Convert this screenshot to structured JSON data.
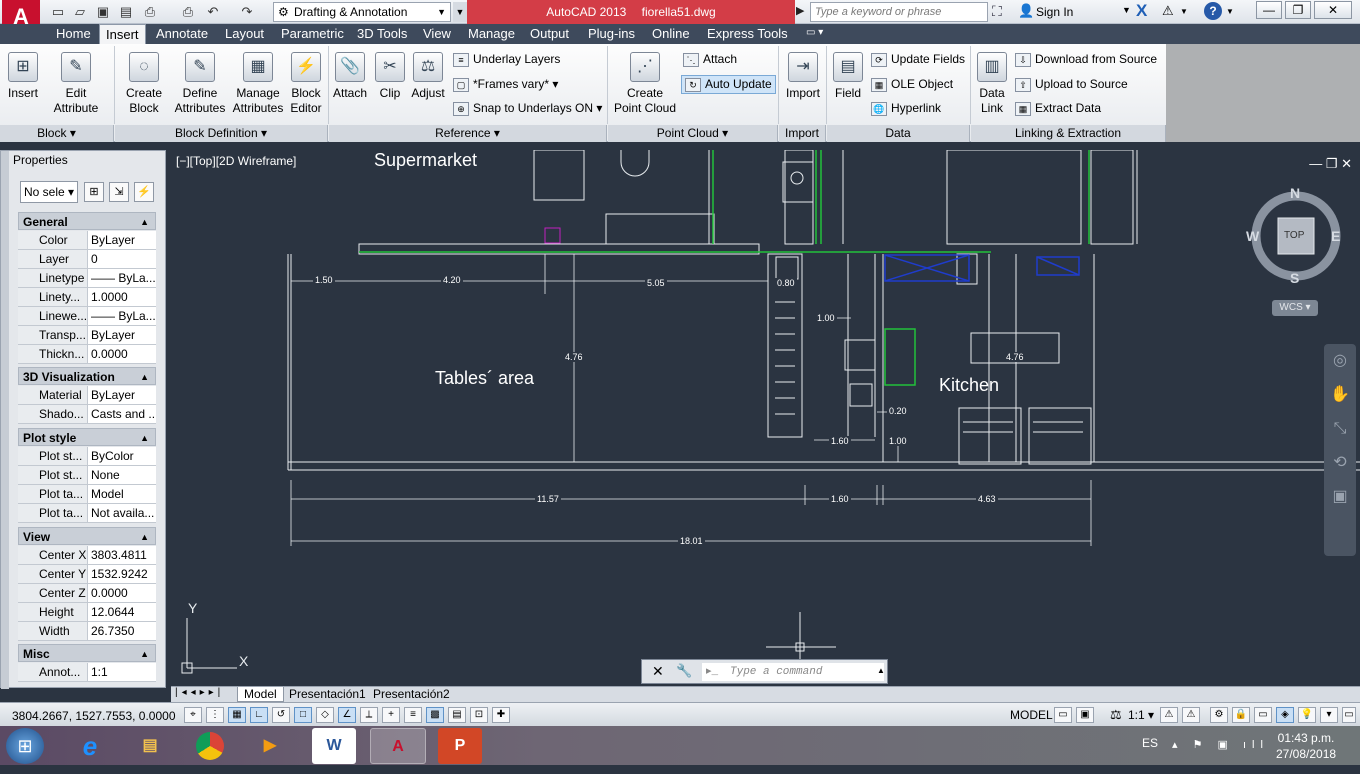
{
  "title_bar": {
    "app_logo": "A",
    "workspace": "Drafting & Annotation",
    "app_name": "AutoCAD 2013",
    "file_name": "fiorella51.dwg",
    "search_placeholder": "Type a keyword or phrase",
    "sign_in": "Sign In"
  },
  "ribbon_tabs": [
    "Home",
    "Insert",
    "Annotate",
    "Layout",
    "Parametric",
    "3D Tools",
    "View",
    "Manage",
    "Output",
    "Plug-ins",
    "Online",
    "Express Tools"
  ],
  "active_tab": "Insert",
  "ribbon": {
    "block": {
      "label": "Block",
      "insert": "Insert",
      "edit_attr_1": "Edit",
      "edit_attr_2": "Attribute"
    },
    "block_def": {
      "label": "Block Definition",
      "create_1": "Create",
      "create_2": "Block",
      "define_1": "Define",
      "define_2": "Attributes",
      "manage_1": "Manage",
      "manage_2": "Attributes",
      "editor_1": "Block",
      "editor_2": "Editor"
    },
    "reference": {
      "label": "Reference",
      "attach": "Attach",
      "clip": "Clip",
      "adjust": "Adjust",
      "underlay_layers": "Underlay Layers",
      "frames": "*Frames vary*",
      "snap": "Snap to Underlays ON"
    },
    "point_cloud": {
      "label": "Point Cloud",
      "create_1": "Create",
      "create_2": "Point Cloud",
      "attach": "Attach",
      "auto_update": "Auto Update"
    },
    "import": {
      "label": "Import",
      "import": "Import"
    },
    "data": {
      "label": "Data",
      "field": "Field",
      "update_fields": "Update Fields",
      "ole_object": "OLE Object",
      "hyperlink": "Hyperlink"
    },
    "linking": {
      "label": "Linking & Extraction",
      "data_link_1": "Data",
      "data_link_2": "Link",
      "download": "Download from Source",
      "upload": "Upload to Source",
      "extract": "Extract  Data"
    }
  },
  "properties": {
    "title": "Properties",
    "selection": "No sele",
    "sections": {
      "general": {
        "title": "General",
        "rows": [
          [
            "Color",
            "ByLayer"
          ],
          [
            "Layer",
            "0"
          ],
          [
            "Linetype",
            "—— ByLa..."
          ],
          [
            "Linety...",
            "1.0000"
          ],
          [
            "Linewe...",
            "—— ByLa..."
          ],
          [
            "Transp...",
            "ByLayer"
          ],
          [
            "Thickn...",
            "0.0000"
          ]
        ]
      },
      "viz3d": {
        "title": "3D Visualization",
        "rows": [
          [
            "Material",
            "ByLayer"
          ],
          [
            "Shado...",
            "Casts and ..."
          ]
        ]
      },
      "plot": {
        "title": "Plot style",
        "rows": [
          [
            "Plot st...",
            "ByColor"
          ],
          [
            "Plot st...",
            "None"
          ],
          [
            "Plot ta...",
            "Model"
          ],
          [
            "Plot ta...",
            "Not availa..."
          ]
        ]
      },
      "view": {
        "title": "View",
        "rows": [
          [
            "Center X",
            "3803.4811"
          ],
          [
            "Center Y",
            "1532.9242"
          ],
          [
            "Center Z",
            "0.0000"
          ],
          [
            "Height",
            "12.0644"
          ],
          [
            "Width",
            "26.7350"
          ]
        ]
      },
      "misc": {
        "title": "Misc",
        "rows": [
          [
            "Annot...",
            "1:1"
          ]
        ]
      }
    }
  },
  "viewport": {
    "label": "[−][Top][2D Wireframe]",
    "rooms": {
      "supermarket": "Supermarket",
      "tables": "Tables´ area",
      "kitchen": "Kitchen"
    },
    "dims": {
      "d150": "1.50",
      "d420": "4.20",
      "d505": "5.05",
      "d080": "0.80",
      "d100a": "1.00",
      "d476a": "4.76",
      "d476b": "4.76",
      "d020": "0.20",
      "d160a": "1.60",
      "d100b": "1.00",
      "d1157": "11.57",
      "d160b": "1.60",
      "d463": "4.63",
      "d1801": "18.01"
    },
    "viewcube": {
      "top": "TOP",
      "n": "N",
      "s": "S",
      "e": "E",
      "w": "W",
      "wcs": "WCS"
    },
    "ucs": {
      "x": "X",
      "y": "Y"
    }
  },
  "command_line": {
    "placeholder": "Type  a  command"
  },
  "layout_tabs": [
    "Model",
    "Presentación1",
    "Presentación2"
  ],
  "status": {
    "coords": "3804.2667, 1527.7553, 0.0000",
    "model": "MODEL",
    "scale": "1:1"
  },
  "taskbar": {
    "lang": "ES",
    "time": "01:43 p.m.",
    "date": "27/08/2018"
  },
  "colors": {
    "accent_red": "#d33d47",
    "drawing_bg": "#2b3441",
    "green_line": "#22c23a",
    "blue_entity": "#1f3ccc",
    "magenta": "#c020c0"
  }
}
